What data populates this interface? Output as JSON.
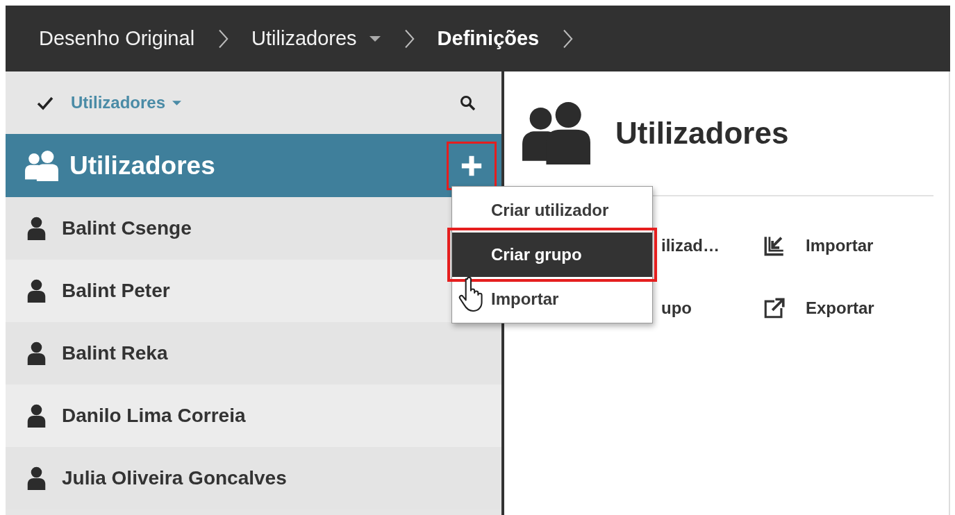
{
  "breadcrumbs": [
    {
      "label": "Desenho Original",
      "dropdown": false,
      "current": false
    },
    {
      "label": "Utilizadores",
      "dropdown": true,
      "current": false
    },
    {
      "label": "Definições",
      "dropdown": false,
      "current": true
    }
  ],
  "sidebar": {
    "filter": {
      "label": "Utilizadores",
      "checked": true
    },
    "header": {
      "title": "Utilizadores",
      "add_highlighted": true
    },
    "items": [
      {
        "name": "Balint Csenge"
      },
      {
        "name": "Balint Peter"
      },
      {
        "name": "Balint Reka"
      },
      {
        "name": "Danilo Lima Correia"
      },
      {
        "name": "Julia Oliveira Goncalves"
      }
    ]
  },
  "content": {
    "title": "Utilizadores",
    "actions": [
      {
        "label": "ilizad…",
        "kind": "covered"
      },
      {
        "label": "Importar",
        "kind": "import"
      },
      {
        "label": "upo",
        "kind": "covered"
      },
      {
        "label": "Exportar",
        "kind": "export"
      }
    ]
  },
  "menu": {
    "items": [
      {
        "label": "Criar utilizador",
        "selected": false,
        "highlighted": false
      },
      {
        "label": "Criar grupo",
        "selected": true,
        "highlighted": true
      },
      {
        "label": "Importar",
        "selected": false,
        "highlighted": false
      }
    ]
  }
}
